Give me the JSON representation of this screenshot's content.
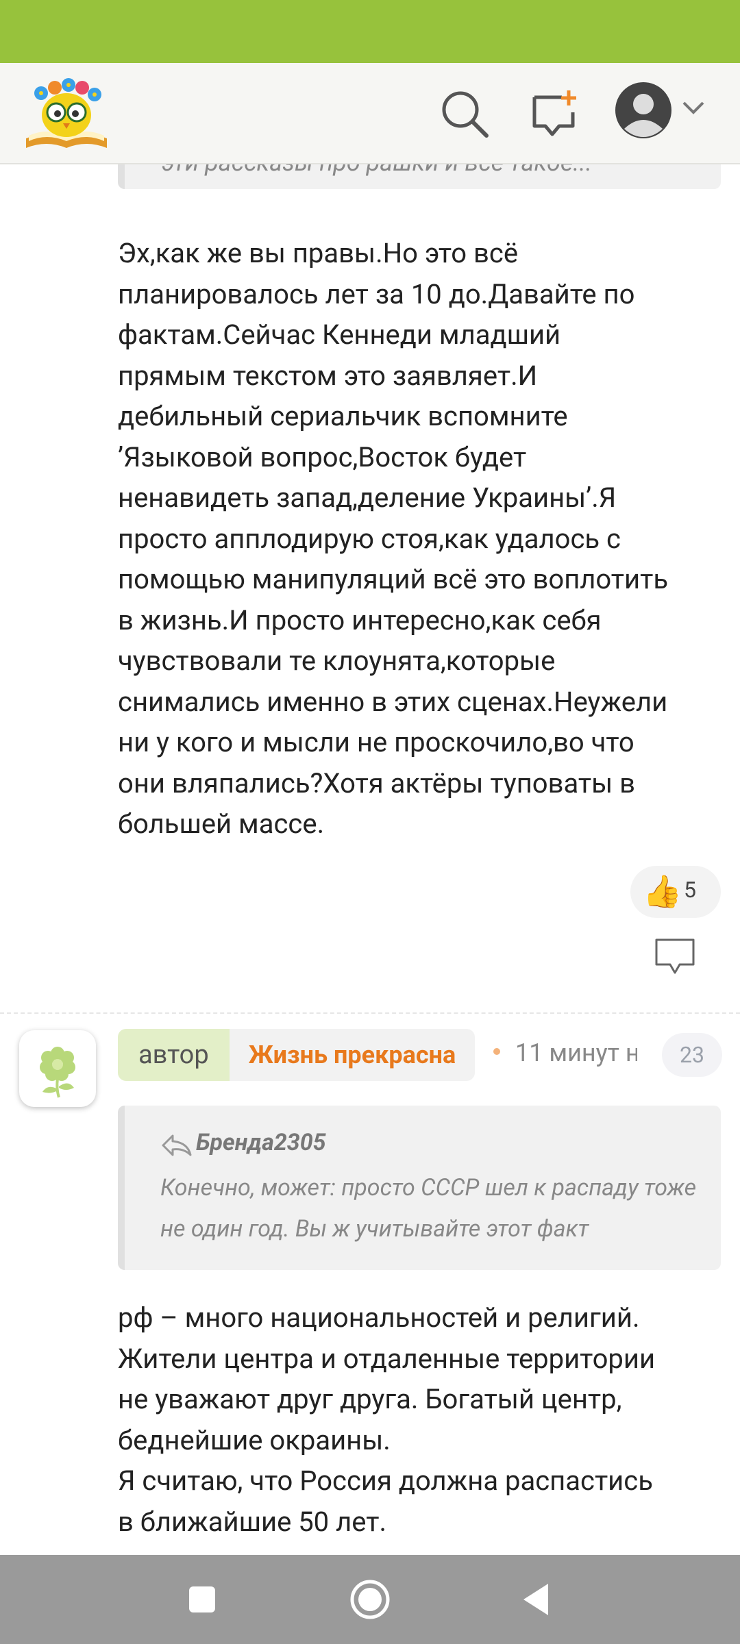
{
  "header": {
    "logo_icon": "owl-on-book-logo",
    "search_icon": "search-icon",
    "new_post_icon": "new-post-icon",
    "profile_icon": "user-avatar-icon"
  },
  "colors": {
    "status_bar": "#97c23c",
    "author_badge_bg": "#e3efc8",
    "author_name": "#e8791c",
    "navbar": "#9a9a9a"
  },
  "comment1": {
    "quoted_text_partial": "эти рассказы про рашки и всё такое...",
    "text": "Эх,как же вы правы.Но это всё\nпланировалось лет за 10 до.Давайте по\nфактам.Сейчас Кеннеди младший\nпрямым текстом это заявляет.И\nдебильный сериальчик вспомните\n’Языковой вопрос,Восток будет\nненавидеть запад,деление Украины’.Я\nпросто апплодирую стоя,как удалось с\nпомощью манипуляций всё это воплотить\nв жизнь.И просто интересно,как себя\nчувствовали те клоунята,которые\nснимались именно в этих сценах.Неужели\nни у кого и мысли не проскочило,во что\nони вляпались?Хотя актёры туповаты в\nбольшей массе.",
    "like_emoji": "👍",
    "likes": "5"
  },
  "comment2": {
    "author_label": "автор",
    "author_name": "Жизнь прекрасна",
    "time": "11 минут н",
    "count": "23",
    "quote_user": "Бренда2305",
    "quote_text": "Конечно, может: просто СССР шел к распаду тоже не один год. Вы ж учитывайте этот факт",
    "text": "рф – много национальностей и религий.\nЖители центра и отдаленные территории\nне уважают друг друга. Богатый центр,\nбеднейшие окраины.\nЯ считаю, что Россия должна распастись\nв ближайшие 50 лет."
  }
}
